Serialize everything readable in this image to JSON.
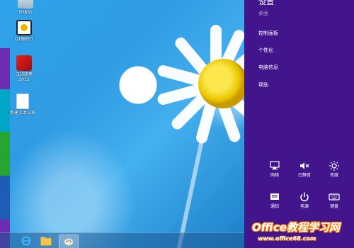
{
  "desktop": {
    "icons": [
      {
        "label": "回收站"
      },
      {
        "label": "Q1随时行"
      },
      {
        "label": "汉印简笔\n2012"
      },
      {
        "label": "新建文本文档"
      }
    ]
  },
  "taskbar": {
    "items": [
      {
        "name": "internet-explorer"
      },
      {
        "name": "file-explorer"
      },
      {
        "name": "paint"
      }
    ]
  },
  "charms": {
    "title": "设置",
    "subtitle": "桌面",
    "links": [
      "控制面板",
      "个性化",
      "电脑信息",
      "帮助"
    ],
    "quick_settings": [
      {
        "label": "网络",
        "icon": "network-icon"
      },
      {
        "label": "已静音",
        "icon": "muted-speaker-icon"
      },
      {
        "label": "亮度",
        "icon": "brightness-icon"
      },
      {
        "label": "通知",
        "icon": "notifications-icon"
      },
      {
        "label": "电源",
        "icon": "power-icon"
      },
      {
        "label": "键盘",
        "icon": "keyboard-icon"
      }
    ]
  },
  "watermark": {
    "text": "Office教程学习网",
    "url": "www.office68.com"
  }
}
